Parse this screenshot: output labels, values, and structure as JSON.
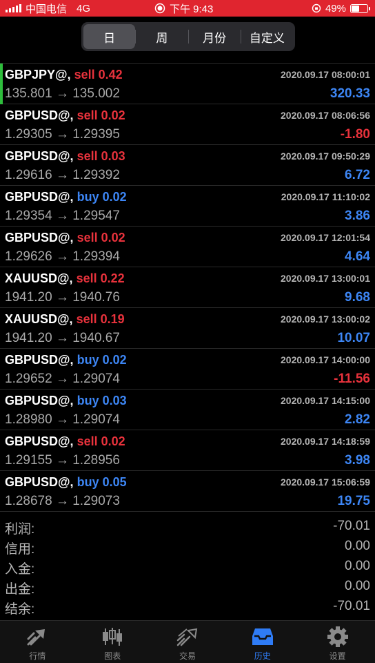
{
  "status_bar": {
    "carrier": "中国电信",
    "network": "4G",
    "time": "下午 9:43",
    "battery": "49%",
    "battery_level": 0.49
  },
  "period_tabs": [
    {
      "label": "日",
      "active": true
    },
    {
      "label": "周",
      "active": false
    },
    {
      "label": "月份",
      "active": false
    },
    {
      "label": "自定义",
      "active": false
    }
  ],
  "deals": [
    {
      "symbol": "GBPJPY@,",
      "side": "sell",
      "volume": "0.42",
      "time": "2020.09.17 08:00:01",
      "prices": "135.801 → 135.002",
      "profit": "320.33",
      "positive": true,
      "highlight": true
    },
    {
      "symbol": "GBPUSD@,",
      "side": "sell",
      "volume": "0.02",
      "time": "2020.09.17 08:06:56",
      "prices": "1.29305 → 1.29395",
      "profit": "-1.80",
      "positive": false
    },
    {
      "symbol": "GBPUSD@,",
      "side": "sell",
      "volume": "0.03",
      "time": "2020.09.17 09:50:29",
      "prices": "1.29616 → 1.29392",
      "profit": "6.72",
      "positive": true
    },
    {
      "symbol": "GBPUSD@,",
      "side": "buy",
      "volume": "0.02",
      "time": "2020.09.17 11:10:02",
      "prices": "1.29354 → 1.29547",
      "profit": "3.86",
      "positive": true
    },
    {
      "symbol": "GBPUSD@,",
      "side": "sell",
      "volume": "0.02",
      "time": "2020.09.17 12:01:54",
      "prices": "1.29626 → 1.29394",
      "profit": "4.64",
      "positive": true
    },
    {
      "symbol": "XAUUSD@,",
      "side": "sell",
      "volume": "0.22",
      "time": "2020.09.17 13:00:01",
      "prices": "1941.20 → 1940.76",
      "profit": "9.68",
      "positive": true
    },
    {
      "symbol": "XAUUSD@,",
      "side": "sell",
      "volume": "0.19",
      "time": "2020.09.17 13:00:02",
      "prices": "1941.20 → 1940.67",
      "profit": "10.07",
      "positive": true
    },
    {
      "symbol": "GBPUSD@,",
      "side": "buy",
      "volume": "0.02",
      "time": "2020.09.17 14:00:00",
      "prices": "1.29652 → 1.29074",
      "profit": "-11.56",
      "positive": false
    },
    {
      "symbol": "GBPUSD@,",
      "side": "buy",
      "volume": "0.03",
      "time": "2020.09.17 14:15:00",
      "prices": "1.28980 → 1.29074",
      "profit": "2.82",
      "positive": true
    },
    {
      "symbol": "GBPUSD@,",
      "side": "sell",
      "volume": "0.02",
      "time": "2020.09.17 14:18:59",
      "prices": "1.29155 → 1.28956",
      "profit": "3.98",
      "positive": true
    },
    {
      "symbol": "GBPUSD@,",
      "side": "buy",
      "volume": "0.05",
      "time": "2020.09.17 15:06:59",
      "prices": "1.28678 → 1.29073",
      "profit": "19.75",
      "positive": true
    }
  ],
  "summary": [
    {
      "label": "利润:",
      "value": "-70.01"
    },
    {
      "label": "信用:",
      "value": "0.00"
    },
    {
      "label": "入金:",
      "value": "0.00"
    },
    {
      "label": "出金:",
      "value": "0.00"
    },
    {
      "label": "结余:",
      "value": "-70.01"
    }
  ],
  "bottom_tabs": [
    {
      "label": "行情",
      "icon": "quotes-icon",
      "active": false
    },
    {
      "label": "图表",
      "icon": "chart-icon",
      "active": false
    },
    {
      "label": "交易",
      "icon": "trade-icon",
      "active": false
    },
    {
      "label": "历史",
      "icon": "history-icon",
      "active": true
    },
    {
      "label": "设置",
      "icon": "settings-icon",
      "active": false
    }
  ],
  "colors": {
    "status_bar": "#e0252f",
    "sell": "#e8323c",
    "buy": "#3d86f5",
    "profit_positive": "#3d86f5",
    "profit_negative": "#e8323c",
    "active_tab": "#2f7cf6",
    "row_indicator": "#2ebd3c"
  }
}
